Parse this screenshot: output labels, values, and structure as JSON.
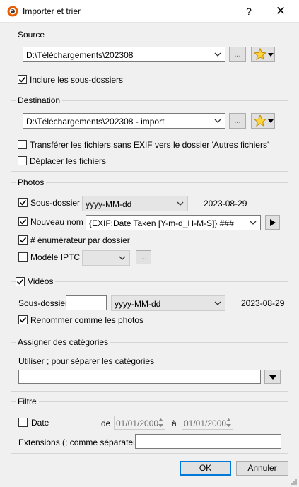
{
  "window": {
    "title": "Importer et trier",
    "help": "?",
    "close": "✕"
  },
  "source": {
    "legend": "Source",
    "path": "D:\\Téléchargements\\202308",
    "browse": "...",
    "include_subfolders": "Inclure les sous-dossiers",
    "include_subfolders_checked": true
  },
  "destination": {
    "legend": "Destination",
    "path": "D:\\Téléchargements\\202308 - import",
    "browse": "...",
    "move_no_exif": "Transférer les fichiers sans EXIF vers le dossier 'Autres fichiers'",
    "move_no_exif_checked": false,
    "move_files": "Déplacer les fichiers",
    "move_files_checked": false
  },
  "photos": {
    "legend": "Photos",
    "subfolder_label": "Sous-dossier",
    "subfolder_checked": true,
    "subfolder_format": "yyyy-MM-dd",
    "subfolder_preview": "2023-08-29",
    "rename_label": "Nouveau nom",
    "rename_checked": true,
    "rename_pattern": "{EXIF:Date Taken [Y-m-d_H-M-S]} ###",
    "enumerator_label": "# énumérateur par dossier",
    "enumerator_checked": true,
    "iptc_label": "Modèle IPTC",
    "iptc_checked": false,
    "iptc_value": "",
    "iptc_browse": "..."
  },
  "videos": {
    "legend": "Vidéos",
    "checked": true,
    "subfolder_label": "Sous-dossier",
    "subfolder_value": "",
    "subfolder_format": "yyyy-MM-dd",
    "subfolder_preview": "2023-08-29",
    "rename_like_photos": "Renommer comme les photos",
    "rename_like_photos_checked": true
  },
  "categories": {
    "legend": "Assigner des catégories",
    "hint": "Utiliser ; pour séparer les catégories",
    "value": ""
  },
  "filter": {
    "legend": "Filtre",
    "date_label": "Date",
    "date_checked": false,
    "from_label": "de",
    "from_value": "01/01/2000",
    "to_label": "à",
    "to_value": "01/01/2000",
    "extensions_label": "Extensions (; comme séparateur)",
    "extensions_value": ""
  },
  "buttons": {
    "ok": "OK",
    "cancel": "Annuler"
  }
}
